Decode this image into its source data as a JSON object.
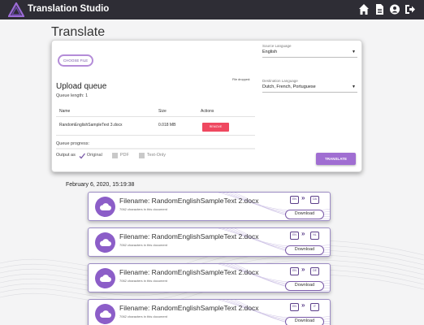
{
  "app": {
    "title": "Translation Studio"
  },
  "nav": {
    "icons": [
      "home-icon",
      "document-icon",
      "user-icon",
      "logout-icon"
    ]
  },
  "page": {
    "title": "Translate"
  },
  "upload": {
    "choose_file_label": "CHOOSE FILE",
    "file_dropped_label": "File dropped:",
    "queue_title": "Upload queue",
    "queue_length": "Queue length: 1",
    "columns": [
      "Name",
      "Size",
      "Actions"
    ],
    "rows": [
      {
        "name": "RandomEnglishSampleText 3.docx",
        "size": "0.018 MB",
        "action": "REMOVE"
      }
    ],
    "queue_progress_label": "Queue progress:",
    "queue_progress": 0,
    "output_as_label": "Output as",
    "output_options": [
      {
        "label": "Original",
        "checked": true
      },
      {
        "label": "PDF",
        "checked": false
      },
      {
        "label": "Text-Only",
        "checked": false
      }
    ]
  },
  "languages": {
    "source_label": "Source Language",
    "source_value": "English",
    "destination_label": "Destination Language",
    "destination_value": "Dutch, French, Portuguese"
  },
  "translate_button": "TRANSLATE",
  "history": {
    "date": "February 6, 2020, 15:19:38",
    "files": [
      {
        "filename": "Filename: RandomEnglishSampleText 2.docx",
        "chars": "7062 characters in this document",
        "from": "EN",
        "to": "DA",
        "download": "Download"
      },
      {
        "filename": "Filename: RandomEnglishSampleText 2.docx",
        "chars": "7062 characters in this document",
        "from": "EN",
        "to": "NL",
        "download": "Download"
      },
      {
        "filename": "Filename: RandomEnglishSampleText 2.docx",
        "chars": "7062 characters in this document",
        "from": "EN",
        "to": "DE",
        "download": "Download"
      },
      {
        "filename": "Filename: RandomEnglishSampleText 2.docx",
        "chars": "7062 characters in this document",
        "from": "EN",
        "to": "IT",
        "download": "Download"
      }
    ]
  },
  "colors": {
    "navbar": "#2e2d35",
    "accent": "#a06ed2",
    "remove": "#ef4860",
    "logo": "#9b6bd6"
  }
}
